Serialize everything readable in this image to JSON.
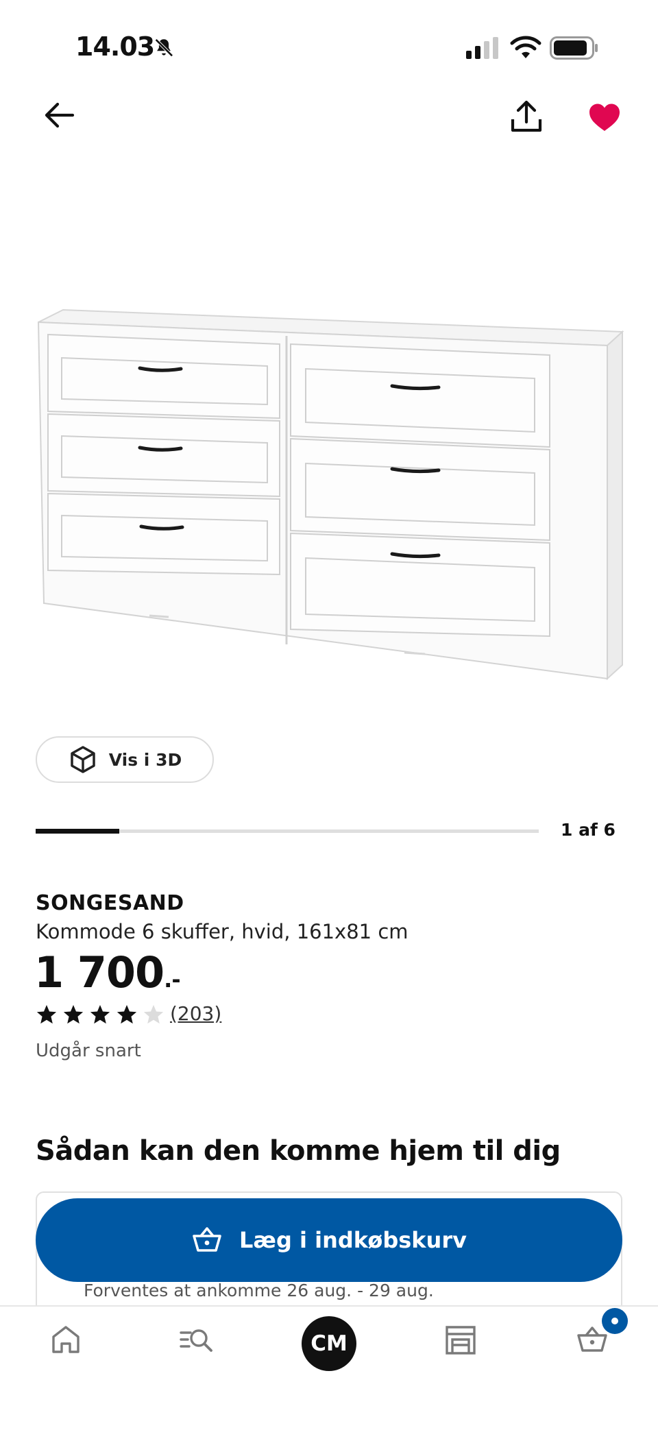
{
  "status_bar": {
    "time": "14.03",
    "icons": [
      "bell-slash-icon",
      "cellular-signal-icon",
      "wifi-icon",
      "battery-icon"
    ]
  },
  "header": {
    "icons": [
      "back-arrow-icon",
      "share-icon",
      "heart-icon"
    ],
    "favorite_active": true,
    "favorite_color": "#e00751"
  },
  "gallery": {
    "view_3d_label": "Vis i 3D",
    "counter": "1 af 6",
    "current": 1,
    "total": 6
  },
  "product": {
    "name": "SONGESAND",
    "description": "Kommode 6 skuffer, hvid, 161x81 cm",
    "price": "1 700",
    "price_suffix": ".-",
    "rating": 4,
    "rating_max": 5,
    "review_count": "(203)",
    "availability": "Udgår snart"
  },
  "delivery": {
    "heading": "Sådan kan den komme hjem til dig",
    "eta": "Forventes at ankomme 26 aug. - 29 aug."
  },
  "cart": {
    "add_label": "Læg i indkøbskurv",
    "button_color": "#0058a3"
  },
  "bottom_nav": {
    "items": [
      "home-icon",
      "search-list-icon",
      "profile-avatar",
      "store-icon",
      "basket-icon"
    ],
    "profile_initials": "CM",
    "badge_color": "#0058a3"
  }
}
